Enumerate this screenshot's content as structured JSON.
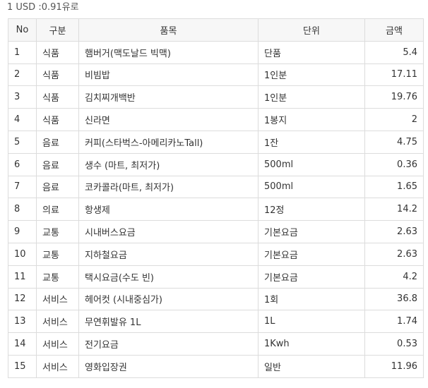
{
  "rate_text": "1 USD :0.91유로",
  "headers": {
    "no": "No",
    "category": "구분",
    "item": "품목",
    "unit": "단위",
    "amount": "금액"
  },
  "rows": [
    {
      "no": "1",
      "category": "식품",
      "item": "햄버거(맥도날드 빅맥)",
      "unit": "단품",
      "amount": "5.4"
    },
    {
      "no": "2",
      "category": "식품",
      "item": "비빔밥",
      "unit": "1인분",
      "amount": "17.11"
    },
    {
      "no": "3",
      "category": "식품",
      "item": "김치찌개백반",
      "unit": "1인분",
      "amount": "19.76"
    },
    {
      "no": "4",
      "category": "식품",
      "item": "신라면",
      "unit": "1봉지",
      "amount": "2"
    },
    {
      "no": "5",
      "category": "음료",
      "item": "커피(스타벅스-아메리카노Tall)",
      "unit": "1잔",
      "amount": "4.75"
    },
    {
      "no": "6",
      "category": "음료",
      "item": "생수 (마트, 최저가)",
      "unit": "500ml",
      "amount": "0.36"
    },
    {
      "no": "7",
      "category": "음료",
      "item": "코카콜라(마트, 최저가)",
      "unit": "500ml",
      "amount": "1.65"
    },
    {
      "no": "8",
      "category": "의료",
      "item": "항생제",
      "unit": "12정",
      "amount": "14.2"
    },
    {
      "no": "9",
      "category": "교통",
      "item": "시내버스요금",
      "unit": "기본요금",
      "amount": "2.63"
    },
    {
      "no": "10",
      "category": "교통",
      "item": "지하철요금",
      "unit": "기본요금",
      "amount": "2.63"
    },
    {
      "no": "11",
      "category": "교통",
      "item": "택시요금(수도 빈)",
      "unit": "기본요금",
      "amount": "4.2"
    },
    {
      "no": "12",
      "category": "서비스",
      "item": "헤어컷 (시내중심가)",
      "unit": "1회",
      "amount": "36.8"
    },
    {
      "no": "13",
      "category": "서비스",
      "item": "무연휘발유 1L",
      "unit": "1L",
      "amount": "1.74"
    },
    {
      "no": "14",
      "category": "서비스",
      "item": "전기요금",
      "unit": "1Kwh",
      "amount": "0.53"
    },
    {
      "no": "15",
      "category": "서비스",
      "item": "영화입장권",
      "unit": "일반",
      "amount": "11.96"
    }
  ]
}
